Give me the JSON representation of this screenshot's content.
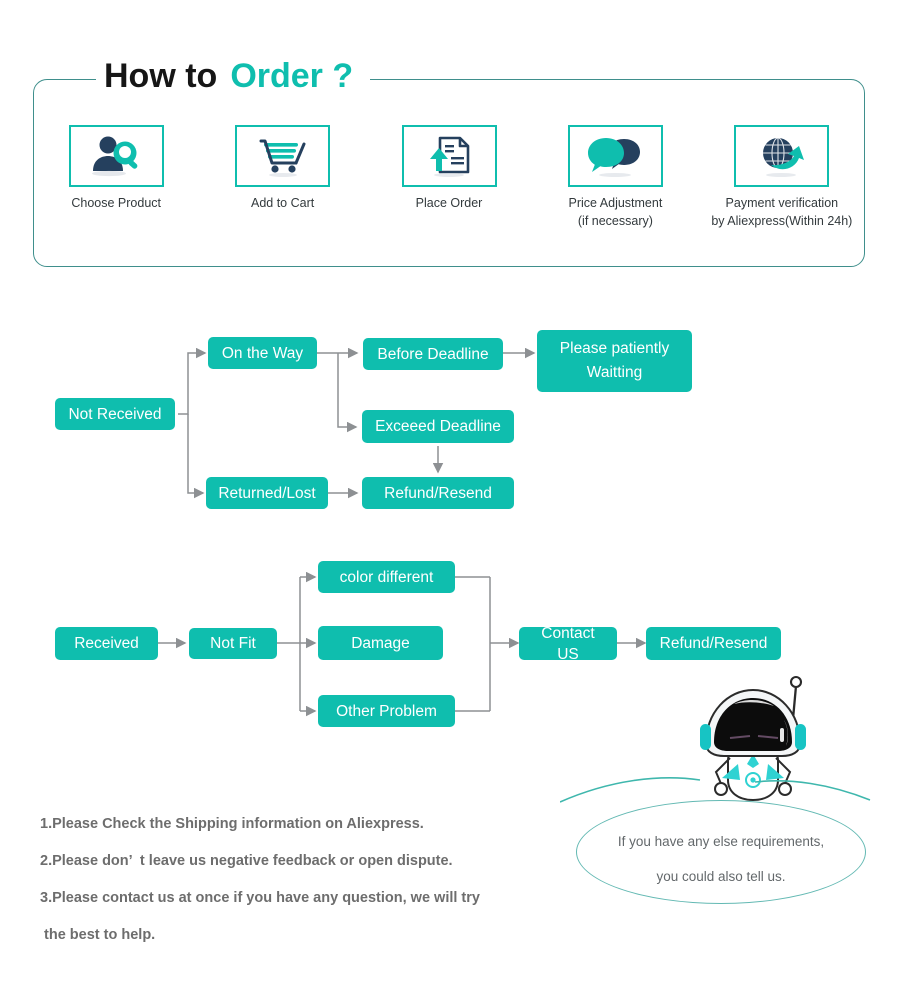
{
  "header": {
    "title_black": "How to",
    "title_teal": "Order ?",
    "steps": [
      {
        "icon": "person-search-icon",
        "label": "Choose  Product"
      },
      {
        "icon": "shopping-cart-icon",
        "label": "Add to Cart"
      },
      {
        "icon": "document-upload-icon",
        "label": "Place  Order"
      },
      {
        "icon": "speech-bubbles-icon",
        "label": "Price Adjustment\n(if necessary)"
      },
      {
        "icon": "globe-arrow-icon",
        "label": "Payment verification\nby Aliexpress(Within 24h)"
      }
    ]
  },
  "flow_not_received": {
    "nodes": {
      "start": "Not Received",
      "on_the_way": "On the Way",
      "before_deadline": "Before Deadline",
      "please_wait": "Please patiently\nWaitting",
      "exceed_deadline": "Exceeed Deadline",
      "returned_lost": "Returned/Lost",
      "refund_resend": "Refund/Resend"
    }
  },
  "flow_received": {
    "nodes": {
      "start": "Received",
      "not_fit": "Not Fit",
      "color_different": "color different",
      "damage": "Damage",
      "other_problem": "Other Problem",
      "contact_us": "Contact US",
      "refund_resend": "Refund/Resend"
    }
  },
  "notes": [
    "1.Please Check the Shipping information on Aliexpress.",
    "2.Please don’  t leave us negative feedback or open dispute.",
    "3.Please contact us at once if you have any question, we will try",
    " the best to help."
  ],
  "bubble": {
    "line1": "If you have any else requirements,",
    "line2": "you could also tell us."
  },
  "colors": {
    "teal": "#0fbeae",
    "navy": "#25405e",
    "panel_border": "#3f8f8c",
    "arrow_gray": "#8d9093",
    "note_gray": "#6d6d6d"
  }
}
